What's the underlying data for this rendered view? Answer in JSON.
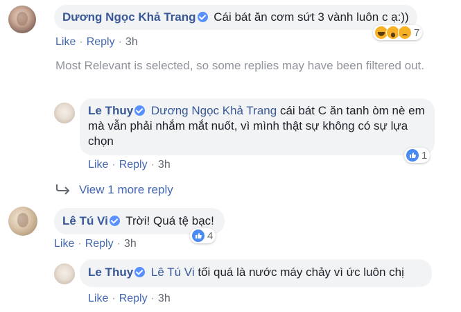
{
  "comments": {
    "trang": {
      "name": "Dương Ngọc Khả Trang",
      "text": "Cái bát ăn cơm sứt 3 vành luôn c ạ:))",
      "like": "Like",
      "reply": "Reply",
      "time": "3h",
      "reaction_count": "7"
    },
    "filter_note": "Most Relevant is selected, so some replies may have been filtered out.",
    "reply1": {
      "name": "Le Thuy",
      "mention": "Dương Ngọc Khả Trang",
      "text": "cái bát C ăn tanh òm nè em mà vẫn phải nhắm mắt nuốt, vì mình thật sự không có sự lựa chọn",
      "like": "Like",
      "reply": "Reply",
      "time": "3h",
      "reaction_count": "1"
    },
    "view_more": "View 1 more reply",
    "vi": {
      "name": "Lê Tú Vi",
      "text": "Trời! Quá tệ bạc!",
      "like": "Like",
      "reply": "Reply",
      "time": "3h",
      "reaction_count": "4"
    },
    "reply2": {
      "name": "Le Thuy",
      "mention": "Lê Tú Vi",
      "text": "tối quá là nước máy chảy vì ức luôn chị",
      "like": "Like",
      "reply": "Reply",
      "time": "3h"
    }
  },
  "colors": {
    "name_link": "#385898",
    "action_link": "#4267b2",
    "bubble_bg": "#f2f3f5",
    "muted_text": "#90949c"
  },
  "icons": [
    "verified-badge-icon",
    "reply-arrow-icon",
    "haha-icon",
    "wow-icon",
    "sad-icon",
    "like-icon"
  ]
}
